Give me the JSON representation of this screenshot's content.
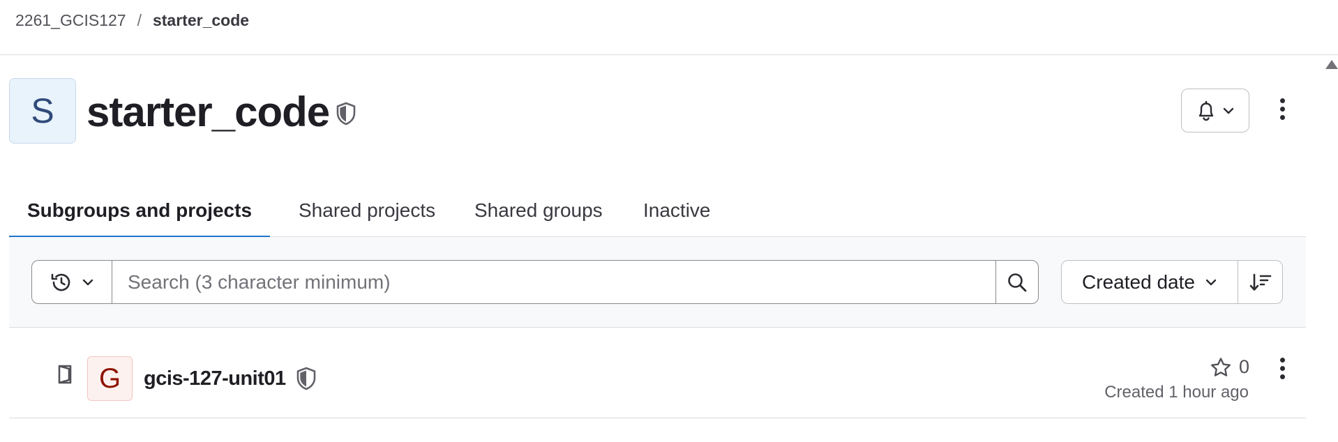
{
  "breadcrumb": {
    "parent": "2261_GCIS127",
    "separator": "/",
    "current": "starter_code"
  },
  "group": {
    "avatar_letter": "S",
    "title": "starter_code",
    "visibility_icon": "shield-icon"
  },
  "tabs": [
    {
      "label": "Subgroups and projects",
      "active": true
    },
    {
      "label": "Shared projects",
      "active": false
    },
    {
      "label": "Shared groups",
      "active": false
    },
    {
      "label": "Inactive",
      "active": false
    }
  ],
  "filter": {
    "search_placeholder": "Search (3 character minimum)",
    "search_value": "",
    "sort_label": "Created date"
  },
  "projects": [
    {
      "avatar_letter": "G",
      "name": "gcis-127-unit01",
      "stars": "0",
      "created": "Created 1 hour ago"
    }
  ],
  "colors": {
    "accent": "#1f75cb",
    "group_avatar_bg": "#e9f3fc",
    "project_avatar_bg": "#fcf1ef",
    "project_avatar_fg": "#8d1300"
  }
}
